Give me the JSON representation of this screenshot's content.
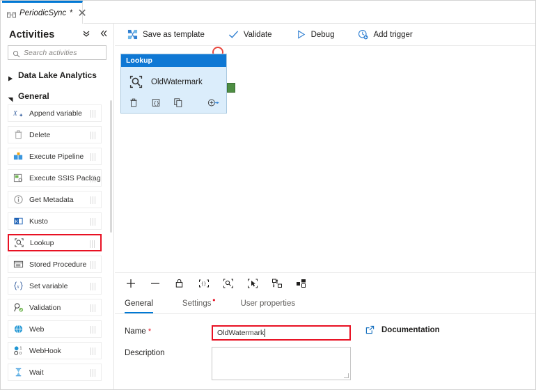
{
  "tab": {
    "icon": "pipeline-icon",
    "title": "PeriodicSync",
    "dirty": "*",
    "close": "✕"
  },
  "sidebar": {
    "title": "Activities",
    "collapse_all_icon": "chevron-double-down-icon",
    "collapse_panel_icon": "chevron-double-left-icon",
    "search": {
      "placeholder": "Search activities",
      "value": "",
      "icon": "search-icon"
    },
    "groups": [
      {
        "label": "Data Lake Analytics",
        "expanded": false,
        "items": []
      },
      {
        "label": "General",
        "expanded": true,
        "items": [
          {
            "label": "Append variable",
            "icon": "append-variable-icon",
            "highlighted": false
          },
          {
            "label": "Delete",
            "icon": "trash-icon",
            "highlighted": false
          },
          {
            "label": "Execute Pipeline",
            "icon": "execute-pipeline-icon",
            "highlighted": false
          },
          {
            "label": "Execute SSIS Package",
            "icon": "ssis-package-icon",
            "highlighted": false
          },
          {
            "label": "Get Metadata",
            "icon": "info-circle-icon",
            "highlighted": false
          },
          {
            "label": "Kusto",
            "icon": "kusto-icon",
            "highlighted": false
          },
          {
            "label": "Lookup",
            "icon": "lookup-icon",
            "highlighted": true
          },
          {
            "label": "Stored Procedure",
            "icon": "stored-procedure-icon",
            "highlighted": false
          },
          {
            "label": "Set variable",
            "icon": "set-variable-icon",
            "highlighted": false
          },
          {
            "label": "Validation",
            "icon": "validation-icon",
            "highlighted": false
          },
          {
            "label": "Web",
            "icon": "web-icon",
            "highlighted": false
          },
          {
            "label": "WebHook",
            "icon": "webhook-icon",
            "highlighted": false
          },
          {
            "label": "Wait",
            "icon": "hourglass-icon",
            "highlighted": false
          }
        ]
      }
    ]
  },
  "commandbar": [
    {
      "label": "Save as template",
      "icon": "save-as-template-icon"
    },
    {
      "label": "Validate",
      "icon": "checkmark-icon"
    },
    {
      "label": "Debug",
      "icon": "play-triangle-icon"
    },
    {
      "label": "Add trigger",
      "icon": "add-trigger-icon"
    }
  ],
  "canvas": {
    "node": {
      "type_label": "Lookup",
      "name": "OldWatermark",
      "icon": "lookup-icon",
      "actions": [
        {
          "icon": "trash-icon",
          "name": "delete"
        },
        {
          "icon": "code-brackets-icon",
          "name": "view-code"
        },
        {
          "icon": "copy-icon",
          "name": "clone"
        },
        {
          "icon": "add-output-arrow-icon",
          "name": "add-output"
        }
      ],
      "output_port_color": "#4e8e43",
      "header_color": "#0f78d4"
    },
    "annotation": {
      "shape": "circle",
      "color": "#e8453c"
    },
    "tools": [
      {
        "icon": "zoom-in-icon",
        "name": "zoom-in"
      },
      {
        "icon": "zoom-out-icon",
        "name": "zoom-out"
      },
      {
        "icon": "lock-icon",
        "name": "lock-canvas"
      },
      {
        "icon": "json-brackets-icon",
        "name": "view-json"
      },
      {
        "icon": "zoom-to-fit-icon",
        "name": "zoom-to-fit"
      },
      {
        "icon": "select-marquee-icon",
        "name": "select"
      },
      {
        "icon": "auto-align-icon",
        "name": "auto-align"
      },
      {
        "icon": "auto-layout-icon",
        "name": "auto-layout"
      }
    ],
    "minimize_icon": "minimize-icon"
  },
  "properties": {
    "tabs": [
      {
        "label": "General",
        "active": true,
        "error": ""
      },
      {
        "label": "Settings",
        "active": false,
        "error": "•"
      },
      {
        "label": "User properties",
        "active": false,
        "error": ""
      }
    ],
    "fields": {
      "name_label": "Name",
      "name_required": "*",
      "name_value": "OldWatermark",
      "description_label": "Description",
      "description_value": ""
    },
    "documentation": {
      "label": "Documentation",
      "icon": "external-link-icon"
    }
  },
  "colors": {
    "accent": "#0078d4",
    "error": "#e81123",
    "node_header": "#0f78d4",
    "port_green": "#4e8e43"
  }
}
